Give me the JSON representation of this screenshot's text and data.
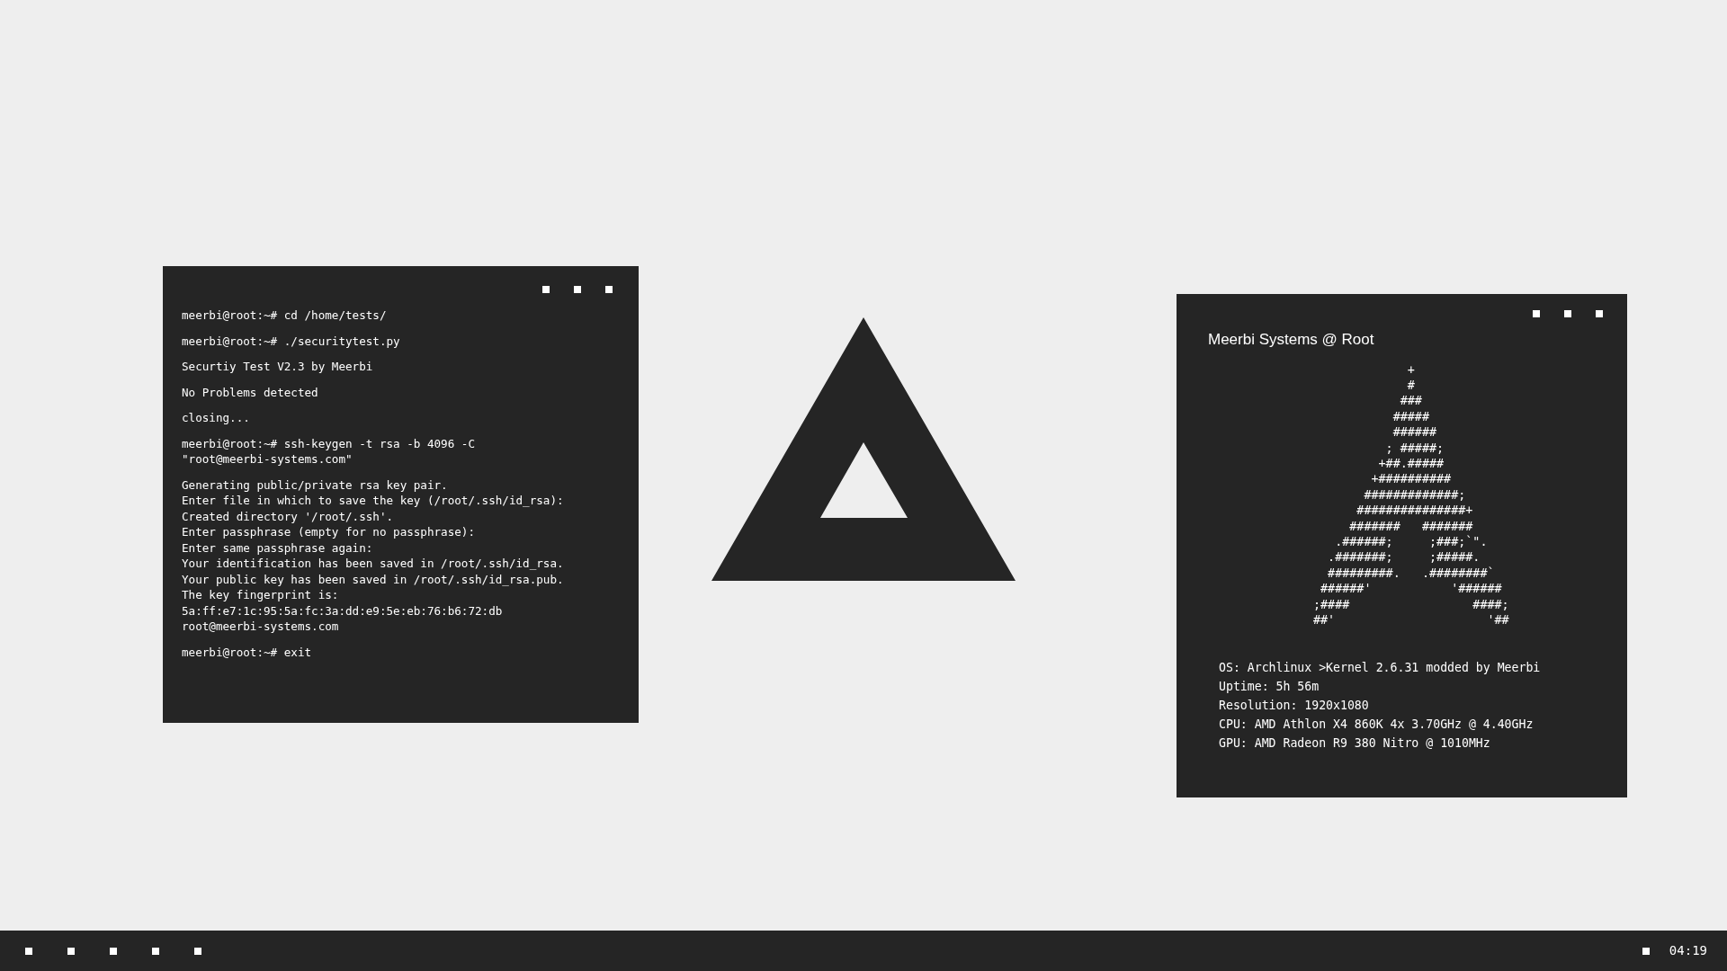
{
  "terminal": {
    "blocks": [
      [
        "meerbi@root:~# cd /home/tests/"
      ],
      [
        "meerbi@root:~# ./securitytest.py"
      ],
      [
        "Securtiy Test V2.3 by Meerbi"
      ],
      [
        "No Problems detected"
      ],
      [
        "closing..."
      ],
      [
        "meerbi@root:~# ssh-keygen -t rsa -b 4096 -C",
        "\"root@meerbi-systems.com\""
      ],
      [
        "Generating public/private rsa key pair.",
        "Enter file in which to save the key (/root/.ssh/id_rsa):",
        "Created directory '/root/.ssh'.",
        "Enter passphrase (empty for no passphrase):",
        "Enter same passphrase again:",
        "Your identification has been saved in /root/.ssh/id_rsa.",
        "Your public key has been saved in /root/.ssh/id_rsa.pub.",
        "The key fingerprint is:",
        "5a:ff:e7:1c:95:5a:fc:3a:dd:e9:5e:eb:76:b6:72:db",
        "root@meerbi-systems.com"
      ],
      [
        "meerbi@root:~# exit"
      ]
    ]
  },
  "sysinfo": {
    "title": "Meerbi Systems @ Root",
    "ascii_art": [
      "             +",
      "             #",
      "            ###",
      "           #####",
      "           ######",
      "          ; #####;",
      "         +##.#####",
      "        +##########",
      "       #############;",
      "      ###############+",
      "     #######   #######",
      "   .######;     ;###;`\".",
      "  .#######;     ;#####.",
      "  #########.   .########`",
      " ######'           '######",
      ";####                 ####;",
      "##'                     '##"
    ],
    "info": [
      "OS: Archlinux >Kernel 2.6.31 modded by Meerbi",
      "Uptime: 5h 56m",
      "Resolution: 1920x1080",
      "CPU: AMD Athlon X4 860K 4x 3.70GHz @ 4.40GHz",
      "GPU: AMD Radeon R9 380 Nitro @ 1010MHz"
    ]
  },
  "taskbar": {
    "clock": "04:19"
  }
}
